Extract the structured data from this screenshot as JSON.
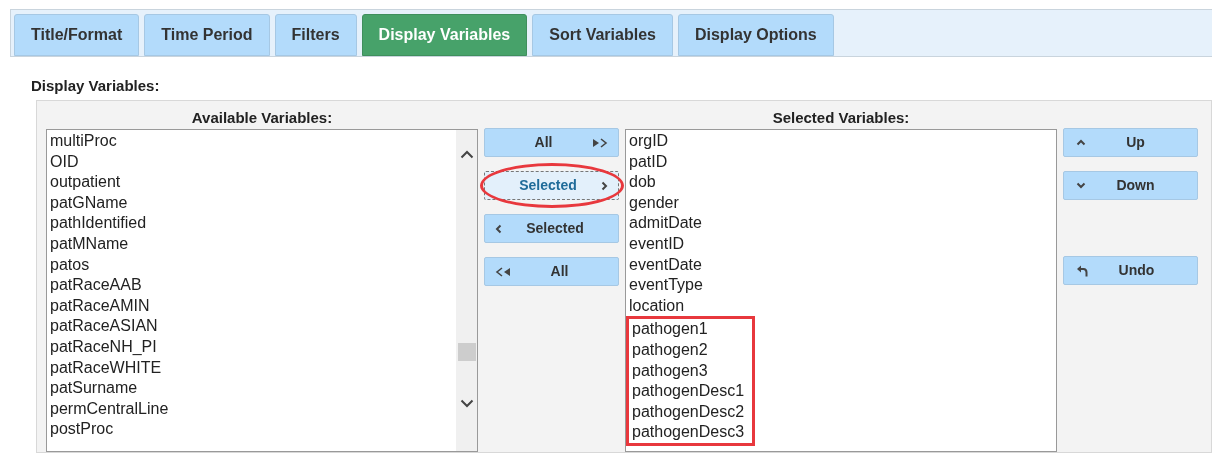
{
  "tabs": [
    {
      "label": "Title/Format",
      "selected": false
    },
    {
      "label": "Time Period",
      "selected": false
    },
    {
      "label": "Filters",
      "selected": false
    },
    {
      "label": "Display Variables",
      "selected": true
    },
    {
      "label": "Sort Variables",
      "selected": false
    },
    {
      "label": "Display Options",
      "selected": false
    }
  ],
  "section_title": "Display Variables:",
  "available": {
    "heading": "Available Variables:",
    "items": [
      "multiProc",
      "OID",
      "outpatient",
      "patGName",
      "pathIdentified",
      "patMName",
      "patos",
      "patRaceAAB",
      "patRaceAMIN",
      "patRaceASIAN",
      "patRaceNH_PI",
      "patRaceWHITE",
      "patSurname",
      "permCentralLine",
      "postProc"
    ]
  },
  "move_buttons": [
    {
      "label": "All",
      "kind": "add_all",
      "focused": false,
      "circled": false
    },
    {
      "label": "Selected",
      "kind": "add",
      "focused": true,
      "circled": true
    },
    {
      "label": "Selected",
      "kind": "remove",
      "focused": false,
      "circled": false
    },
    {
      "label": "All",
      "kind": "remove_all",
      "focused": false,
      "circled": false
    }
  ],
  "selected": {
    "heading": "Selected Variables:",
    "items": [
      {
        "label": "orgID",
        "boxed": false
      },
      {
        "label": "patID",
        "boxed": false
      },
      {
        "label": "dob",
        "boxed": false
      },
      {
        "label": "gender",
        "boxed": false
      },
      {
        "label": "admitDate",
        "boxed": false
      },
      {
        "label": "eventID",
        "boxed": false
      },
      {
        "label": "eventDate",
        "boxed": false
      },
      {
        "label": "eventType",
        "boxed": false
      },
      {
        "label": "location",
        "boxed": false
      },
      {
        "label": "pathogen1",
        "boxed": true
      },
      {
        "label": "pathogen2",
        "boxed": true
      },
      {
        "label": "pathogen3",
        "boxed": true
      },
      {
        "label": "pathogenDesc1",
        "boxed": true
      },
      {
        "label": "pathogenDesc2",
        "boxed": true
      },
      {
        "label": "pathogenDesc3",
        "boxed": true
      }
    ]
  },
  "order_buttons": [
    {
      "label": "Up",
      "kind": "up"
    },
    {
      "label": "Down",
      "kind": "down"
    },
    {
      "label": "Undo",
      "kind": "undo"
    }
  ]
}
